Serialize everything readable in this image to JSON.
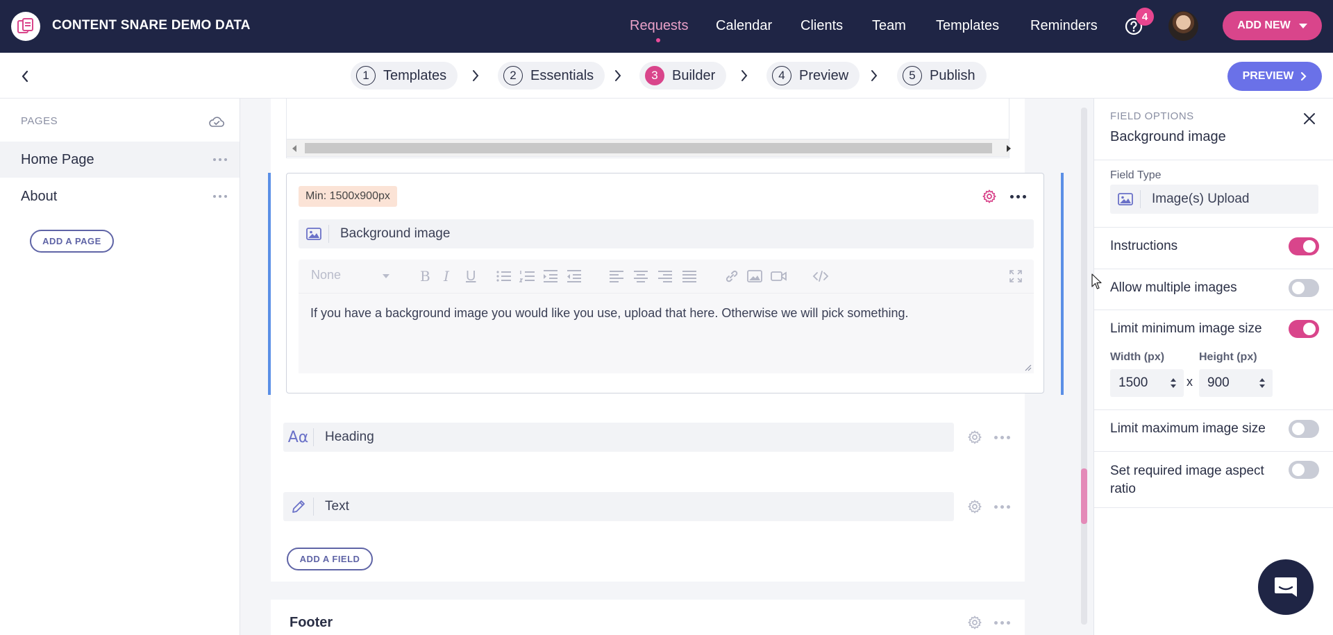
{
  "topnav": {
    "brand": "CONTENT SNARE DEMO DATA",
    "links": [
      "Requests",
      "Calendar",
      "Clients",
      "Team",
      "Templates",
      "Reminders"
    ],
    "help_badge": "4",
    "add_new_label": "ADD NEW"
  },
  "steps": {
    "items": [
      {
        "num": "1",
        "label": "Templates"
      },
      {
        "num": "2",
        "label": "Essentials"
      },
      {
        "num": "3",
        "label": "Builder"
      },
      {
        "num": "4",
        "label": "Preview"
      },
      {
        "num": "5",
        "label": "Publish"
      }
    ],
    "active_index": 2,
    "preview_label": "PREVIEW"
  },
  "sidebar": {
    "heading": "PAGES",
    "pages": [
      "Home Page",
      "About"
    ],
    "add_page_label": "ADD A PAGE"
  },
  "builder": {
    "active_field": {
      "badge": "Min: 1500x900px",
      "label": "Background image",
      "format_select": "None",
      "instructions": "If you have a background image you would like you use, upload that here. Otherwise we will pick something."
    },
    "fields": [
      "Heading",
      "Text"
    ],
    "add_field_label": "ADD A FIELD",
    "next_section_title": "Footer"
  },
  "field_options": {
    "caption": "FIELD OPTIONS",
    "title": "Background image",
    "field_type_label": "Field Type",
    "field_type_value": "Image(s) Upload",
    "instructions_label": "Instructions",
    "instructions_on": true,
    "allow_multiple_label": "Allow multiple images",
    "allow_multiple_on": false,
    "limit_min_label": "Limit minimum image size",
    "limit_min_on": true,
    "width_label": "Width (px)",
    "height_label": "Height (px)",
    "width_value": "1500",
    "height_value": "900",
    "times": "x",
    "limit_max_label": "Limit maximum image size",
    "limit_max_on": false,
    "aspect_label": "Set required image aspect ratio",
    "aspect_on": false
  },
  "colors": {
    "nav_bg": "#1f2545",
    "accent_pink": "#d9458b",
    "preview_blue": "#6a71e8",
    "focus_blue": "#5b8fe6"
  }
}
